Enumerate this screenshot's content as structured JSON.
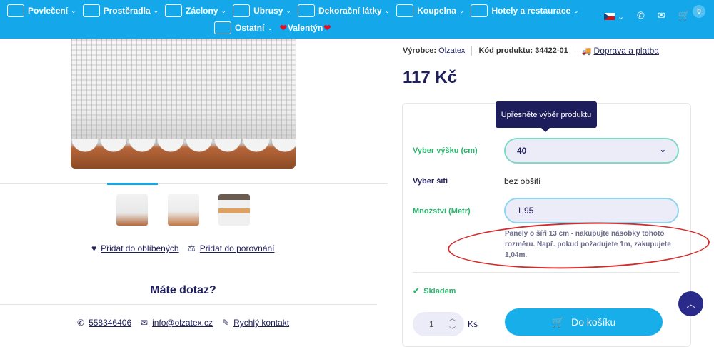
{
  "nav": {
    "items": [
      {
        "label": "Povlečení",
        "icon": "bedding-icon"
      },
      {
        "label": "Prostěradla",
        "icon": "sheet-icon"
      },
      {
        "label": "Záclony",
        "icon": "curtain-icon"
      },
      {
        "label": "Ubrusy",
        "icon": "tablecloth-icon"
      },
      {
        "label": "Dekorační látky",
        "icon": "fabric-icon"
      },
      {
        "label": "Koupelna",
        "icon": "bathtub-icon"
      },
      {
        "label": "Hotely a restaurace",
        "icon": "hotel-bed-icon"
      },
      {
        "label": "Ostatní",
        "icon": "other-icon"
      }
    ],
    "valentine_label": "Valentýn",
    "cart_count": "0"
  },
  "gallery": {
    "favorite_label": "Přidat do oblíbených",
    "compare_label": "Přidat do porovnání"
  },
  "contact": {
    "question": "Máte dotaz?",
    "phone": "558346406",
    "email": "info@olzatex.cz",
    "quick_contact": "Rychlý kontakt"
  },
  "product": {
    "manufacturer_label": "Výrobce:",
    "manufacturer": "Olzatex",
    "code_label": "Kód produktu:",
    "code": "34422-01",
    "shipping_label": "Doprava a platba",
    "price": "117 Kč",
    "tooltip": "Upřesněte výběr produktu",
    "height_label": "Vyber výšku (cm)",
    "height_value": "40",
    "sewing_label": "Vyber šití",
    "sewing_value": "bez obšití",
    "quantity_label": "Množství (Metr)",
    "quantity_value": "1,95",
    "note": "Panely o šíři 13 cm - nakupujte násobky tohoto rozměru. Např. pokud požadujete 1m, zakupujete 1,04m.",
    "stock": "Skladem",
    "count_value": "1",
    "unit": "Ks",
    "add_to_cart": "Do košíku"
  },
  "colors": {
    "accent": "#14a8ea",
    "dark": "#1f1f5c",
    "stock": "#2bb36b",
    "highlight": "#d62b2b"
  }
}
